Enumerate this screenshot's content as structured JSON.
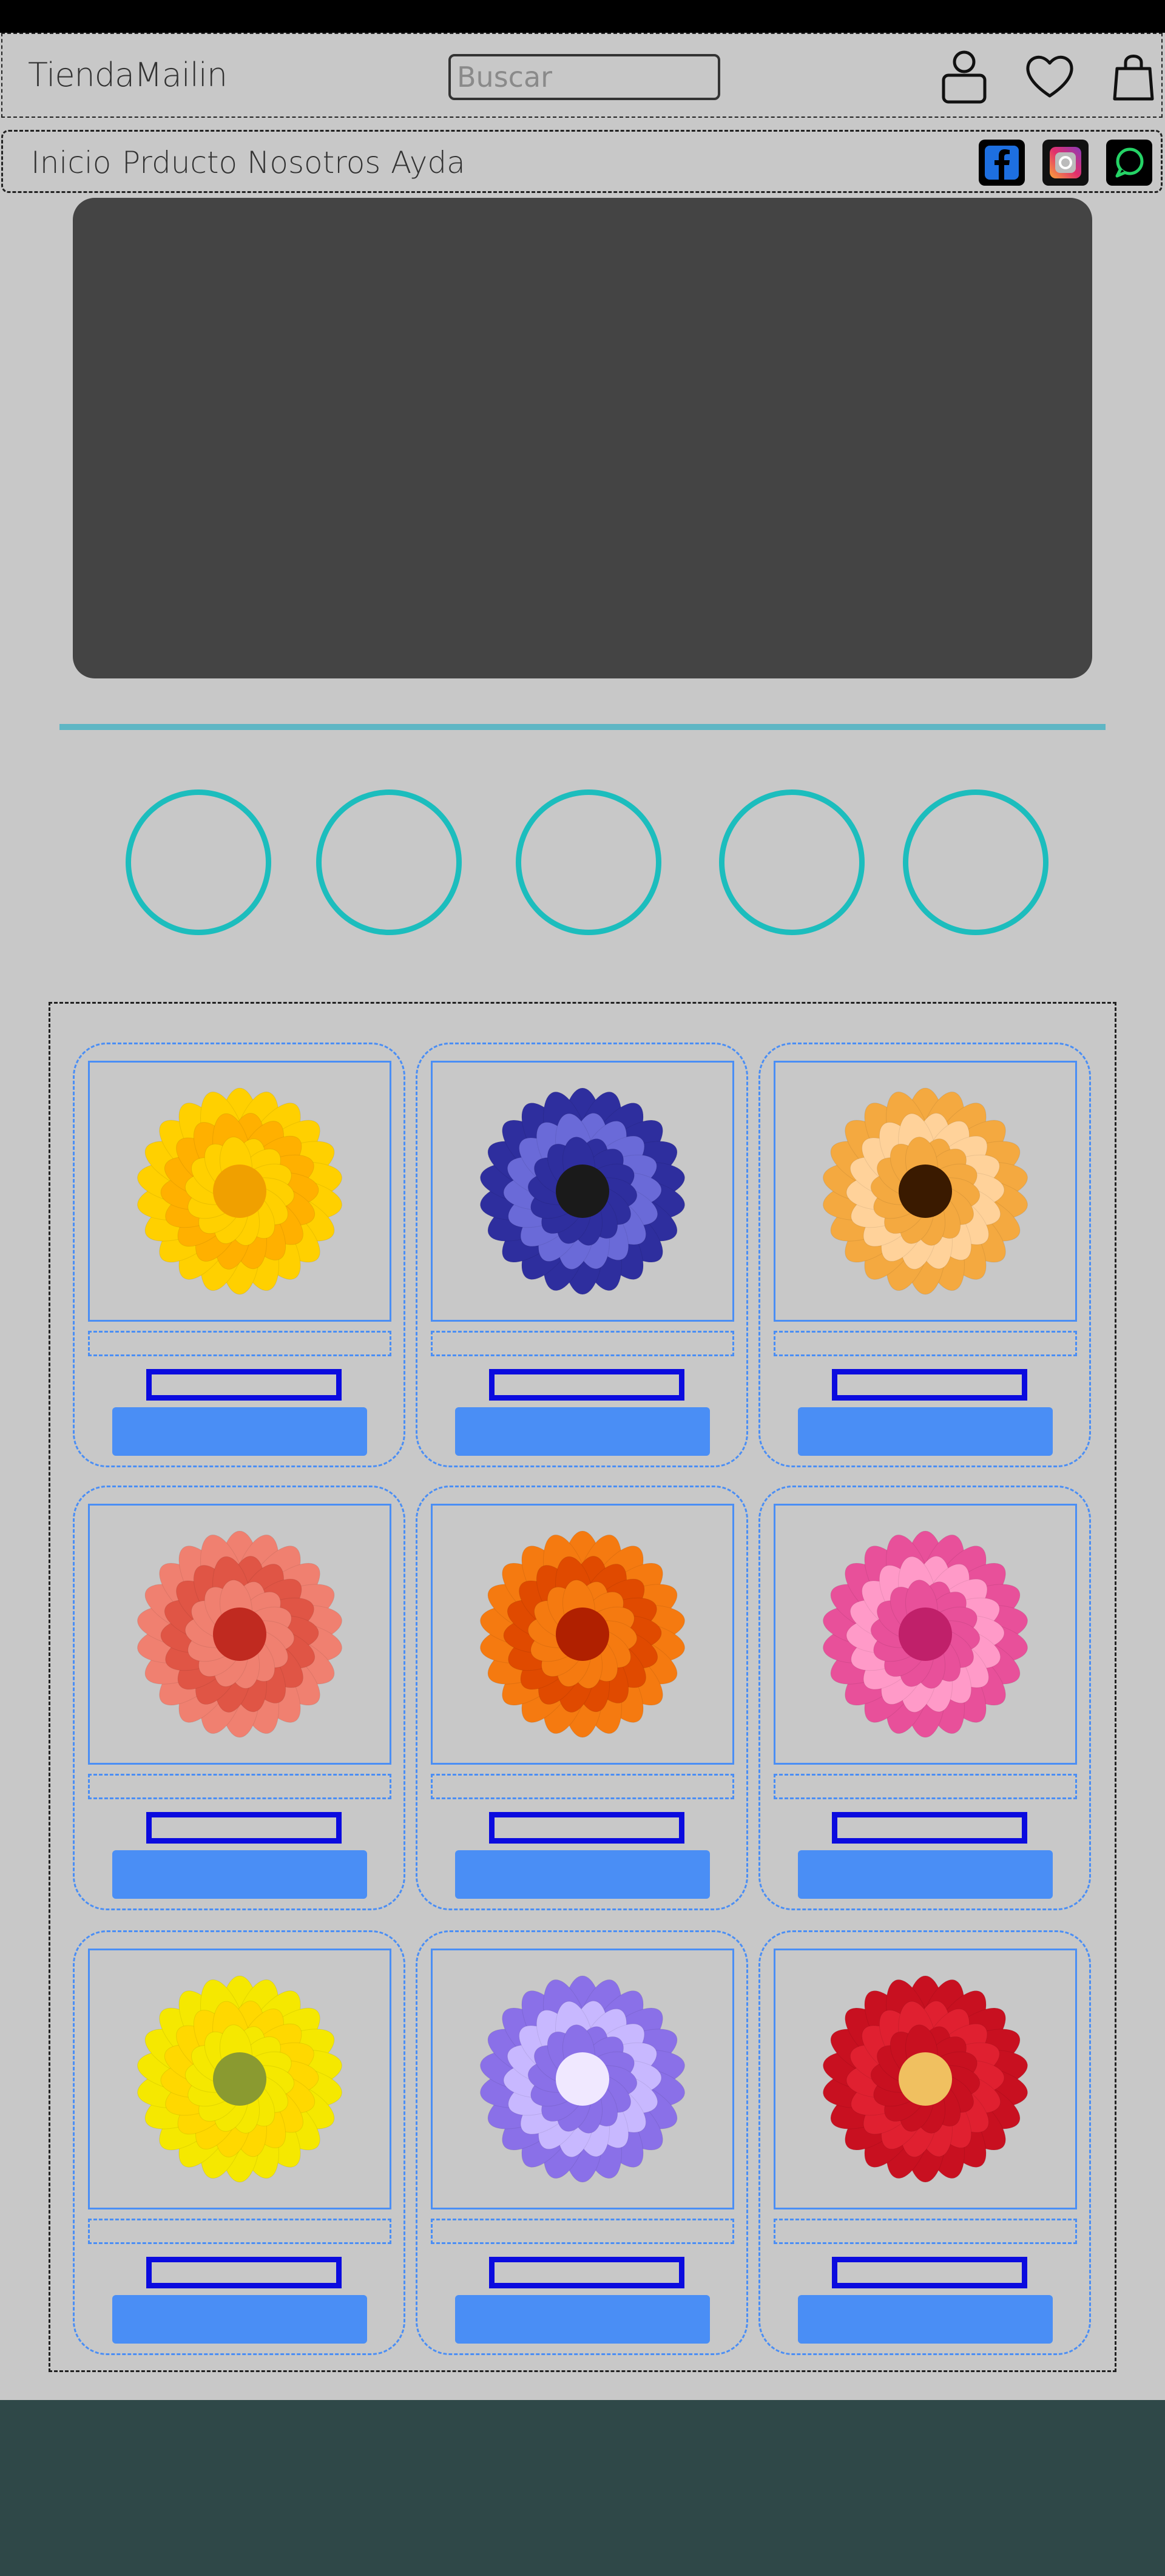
{
  "header": {
    "logo": "TiendaMailin",
    "search": {
      "placeholder": "Buscar",
      "value": ""
    },
    "icons": [
      "user-icon",
      "heart-icon",
      "shopping-bag-icon"
    ]
  },
  "nav": {
    "links": [
      {
        "label": "Inicio"
      },
      {
        "label": "Prducto"
      },
      {
        "label": "Nosotros"
      },
      {
        "label": "Ayda"
      }
    ],
    "social": [
      {
        "name": "facebook-icon",
        "bg": "#000000",
        "fg": "#1877f2"
      },
      {
        "name": "instagram-icon",
        "bg": "#000000",
        "fg": "#e1306c"
      },
      {
        "name": "whatsapp-icon",
        "bg": "#000000",
        "fg": "#25d366"
      }
    ]
  },
  "colors": {
    "background": "#c8c8c8",
    "hero": "#444444",
    "accent_teal": "#1cbdbd",
    "divider": "#5fb6c4",
    "card_border": "#4a8ef5",
    "price_border": "#0b0bdf",
    "footer": "#2f4848"
  },
  "products": [
    {
      "flower": "yellow-calendula",
      "petal": "#ffd000",
      "petal2": "#ffb000",
      "center": "#f0a000"
    },
    {
      "flower": "blue-anemone",
      "petal": "#2e2e9e",
      "petal2": "#6a6ad8",
      "center": "#1a1a1a"
    },
    {
      "flower": "orange-calendula",
      "petal": "#f4a940",
      "petal2": "#ffd29a",
      "center": "#3a1a00"
    },
    {
      "flower": "salmon-dahlia",
      "petal": "#f08070",
      "petal2": "#e05545",
      "center": "#c02a20"
    },
    {
      "flower": "orange-dahlia",
      "petal": "#f57a10",
      "petal2": "#e04a00",
      "center": "#b02000"
    },
    {
      "flower": "pink-dahlia",
      "petal": "#e8509a",
      "petal2": "#ff9ac8",
      "center": "#c0206a"
    },
    {
      "flower": "yellow-gerbera",
      "petal": "#f5e800",
      "petal2": "#ffd800",
      "center": "#8a9a30"
    },
    {
      "flower": "purple-geranium",
      "petal": "#8a70e8",
      "petal2": "#c8b8ff",
      "center": "#f0e8ff"
    },
    {
      "flower": "red-hollyhock",
      "petal": "#c81020",
      "petal2": "#e02030",
      "center": "#f0c060"
    }
  ]
}
